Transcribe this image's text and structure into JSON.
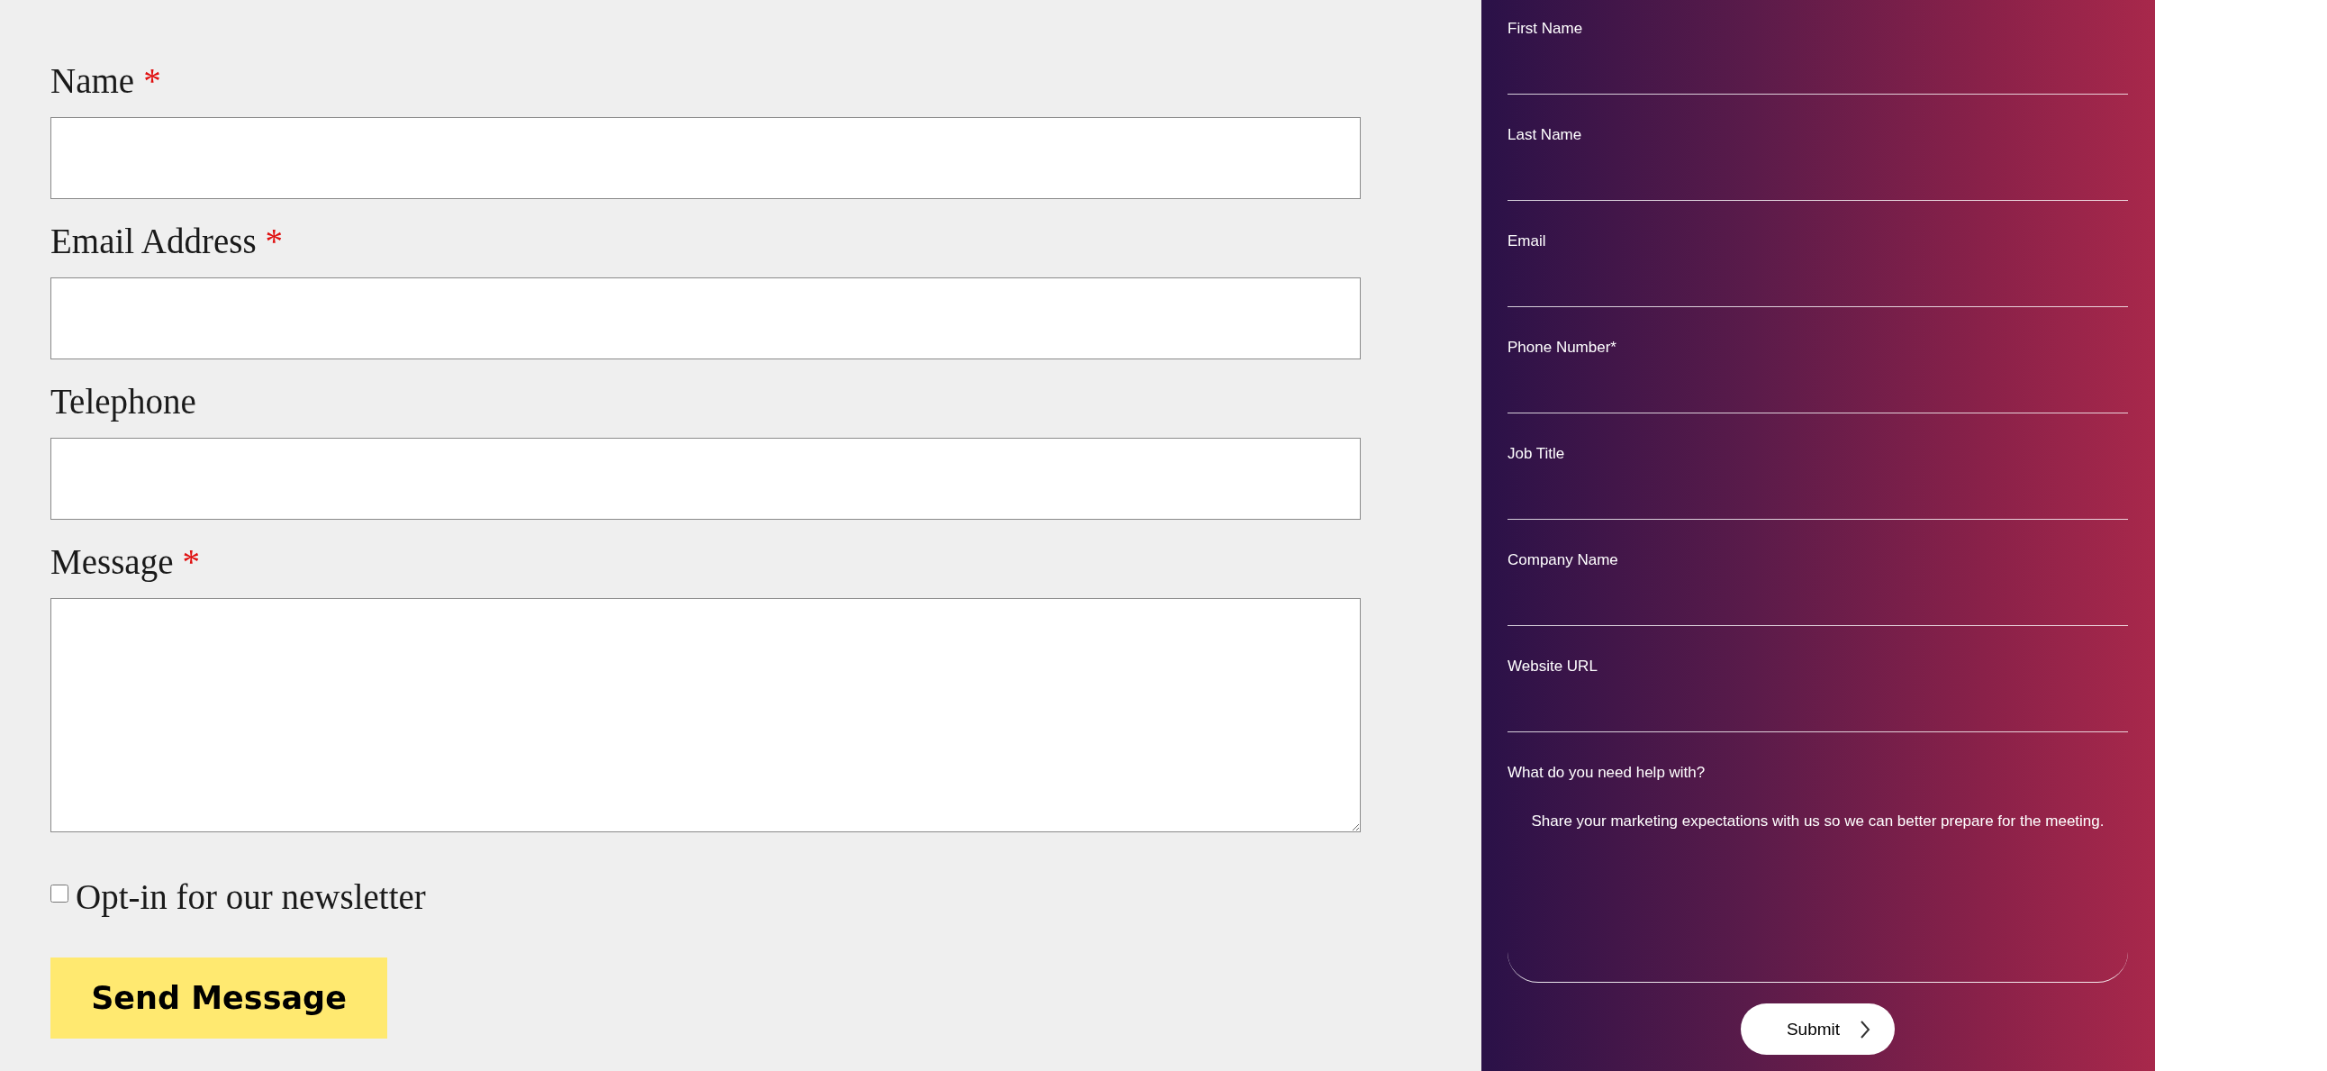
{
  "contact_form": {
    "fields": [
      {
        "kind": "input",
        "label": "Name",
        "mark": "*"
      },
      {
        "kind": "input",
        "label": "Email Address",
        "mark": "*"
      },
      {
        "kind": "input",
        "label": "Telephone"
      },
      {
        "kind": "textarea",
        "label": "Message",
        "mark": "*"
      }
    ],
    "newsletter": {
      "label": "Opt-in for our newsletter",
      "checked": false
    },
    "button": "Send Message"
  },
  "lead_form": {
    "fields": [
      {
        "label": "First Name"
      },
      {
        "label": "Last Name"
      },
      {
        "label": "Email"
      },
      {
        "label": "Phone Number*"
      },
      {
        "label": "Job Title"
      },
      {
        "label": "Company Name"
      },
      {
        "label": "Website URL"
      }
    ],
    "help": {
      "label": "What do you need help with?",
      "placeholder": "Share your marketing expectations with us so we can better prepare for the meeting."
    },
    "submit": "Submit"
  }
}
